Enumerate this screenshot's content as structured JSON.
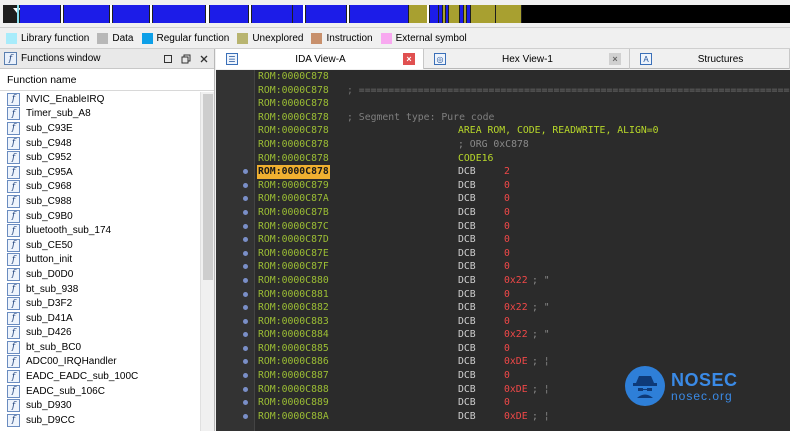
{
  "nav_band": {
    "colors": {
      "background": "#1e1e1e",
      "regular_function": "#1c1ce8",
      "unexplored": "#a8a030",
      "library": "#88e0f0",
      "external": "#000000"
    }
  },
  "legend": {
    "items": [
      {
        "label": "Library function",
        "color": "#a8ecfb"
      },
      {
        "label": "Data",
        "color": "#b8b8b8"
      },
      {
        "label": "Regular function",
        "color": "#0ea0e8"
      },
      {
        "label": "Unexplored",
        "color": "#b8b470"
      },
      {
        "label": "Instruction",
        "color": "#c8906c"
      },
      {
        "label": "External symbol",
        "color": "#f8a8f0"
      }
    ]
  },
  "functions_window": {
    "title": "Functions window",
    "column_header": "Function name",
    "icon": "function-icon",
    "functions": [
      "NVIC_EnableIRQ",
      "Timer_sub_A8",
      "sub_C93E",
      "sub_C948",
      "sub_C952",
      "sub_C95A",
      "sub_C968",
      "sub_C988",
      "sub_C9B0",
      "bluetooth_sub_174",
      "sub_CE50",
      "button_init",
      "sub_D0D0",
      "bt_sub_938",
      "sub_D3F2",
      "sub_D41A",
      "sub_D426",
      "bt_sub_BC0",
      "ADC00_IRQHandler",
      "EADC_EADC_sub_100C",
      "EADC_sub_106C",
      "sub_D930",
      "sub_D9CC"
    ]
  },
  "tabs": [
    {
      "label": "IDA View-A",
      "active": true,
      "icon": "list-view-icon",
      "close": "close-icon-red"
    },
    {
      "label": "Hex View-1",
      "active": false,
      "icon": "hex-view-icon",
      "close": "close-icon-grey"
    },
    {
      "label": "Structures",
      "active": false,
      "icon": "structures-icon"
    }
  ],
  "disassembly": {
    "colors": {
      "background": "#2b2b2b",
      "address": "#9bbd34",
      "address_highlight_bg": "#f0b030",
      "directive": "#b8d82a",
      "operand": "#f04848",
      "comment": "#7f7f7f"
    },
    "lines": [
      {
        "addr": "ROM:0000C878",
        "kind": "blank"
      },
      {
        "addr": "ROM:0000C878",
        "kind": "separator",
        "text": "; ======================================================================================"
      },
      {
        "addr": "ROM:0000C878",
        "kind": "blank"
      },
      {
        "addr": "ROM:0000C878",
        "kind": "comment",
        "text": "; Segment type: Pure code"
      },
      {
        "addr": "ROM:0000C878",
        "kind": "directive",
        "text": "AREA ROM, CODE, READWRITE, ALIGN=0"
      },
      {
        "addr": "ROM:0000C878",
        "kind": "org",
        "text": "; ORG 0xC878"
      },
      {
        "addr": "ROM:0000C878",
        "kind": "directive",
        "text": "CODE16"
      },
      {
        "addr": "ROM:0000C878",
        "kind": "data",
        "highlight": true,
        "dot": true,
        "mn": "DCB",
        "op": "2",
        "cmt": ""
      },
      {
        "addr": "ROM:0000C879",
        "kind": "data",
        "dot": true,
        "mn": "DCB",
        "op": "0",
        "cmt": ""
      },
      {
        "addr": "ROM:0000C87A",
        "kind": "data",
        "dot": true,
        "mn": "DCB",
        "op": "0",
        "cmt": ""
      },
      {
        "addr": "ROM:0000C87B",
        "kind": "data",
        "dot": true,
        "mn": "DCB",
        "op": "0",
        "cmt": ""
      },
      {
        "addr": "ROM:0000C87C",
        "kind": "data",
        "dot": true,
        "mn": "DCB",
        "op": "0",
        "cmt": ""
      },
      {
        "addr": "ROM:0000C87D",
        "kind": "data",
        "dot": true,
        "mn": "DCB",
        "op": "0",
        "cmt": ""
      },
      {
        "addr": "ROM:0000C87E",
        "kind": "data",
        "dot": true,
        "mn": "DCB",
        "op": "0",
        "cmt": ""
      },
      {
        "addr": "ROM:0000C87F",
        "kind": "data",
        "dot": true,
        "mn": "DCB",
        "op": "0",
        "cmt": ""
      },
      {
        "addr": "ROM:0000C880",
        "kind": "data",
        "dot": true,
        "mn": "DCB",
        "op": "0x22",
        "cmt": "; \""
      },
      {
        "addr": "ROM:0000C881",
        "kind": "data",
        "dot": true,
        "mn": "DCB",
        "op": "0",
        "cmt": ""
      },
      {
        "addr": "ROM:0000C882",
        "kind": "data",
        "dot": true,
        "mn": "DCB",
        "op": "0x22",
        "cmt": "; \""
      },
      {
        "addr": "ROM:0000C883",
        "kind": "data",
        "dot": true,
        "mn": "DCB",
        "op": "0",
        "cmt": ""
      },
      {
        "addr": "ROM:0000C884",
        "kind": "data",
        "dot": true,
        "mn": "DCB",
        "op": "0x22",
        "cmt": "; \""
      },
      {
        "addr": "ROM:0000C885",
        "kind": "data",
        "dot": true,
        "mn": "DCB",
        "op": "0",
        "cmt": ""
      },
      {
        "addr": "ROM:0000C886",
        "kind": "data",
        "dot": true,
        "mn": "DCB",
        "op": "0xDE",
        "cmt": "; ¦"
      },
      {
        "addr": "ROM:0000C887",
        "kind": "data",
        "dot": true,
        "mn": "DCB",
        "op": "0",
        "cmt": ""
      },
      {
        "addr": "ROM:0000C888",
        "kind": "data",
        "dot": true,
        "mn": "DCB",
        "op": "0xDE",
        "cmt": "; ¦"
      },
      {
        "addr": "ROM:0000C889",
        "kind": "data",
        "dot": true,
        "mn": "DCB",
        "op": "0",
        "cmt": ""
      },
      {
        "addr": "ROM:0000C88A",
        "kind": "data",
        "dot": true,
        "mn": "DCB",
        "op": "0xDE",
        "cmt": "; ¦"
      }
    ]
  },
  "watermark": {
    "brand": "NOSEC",
    "domain": "nosec.org",
    "icon": "spy-logo-icon"
  }
}
